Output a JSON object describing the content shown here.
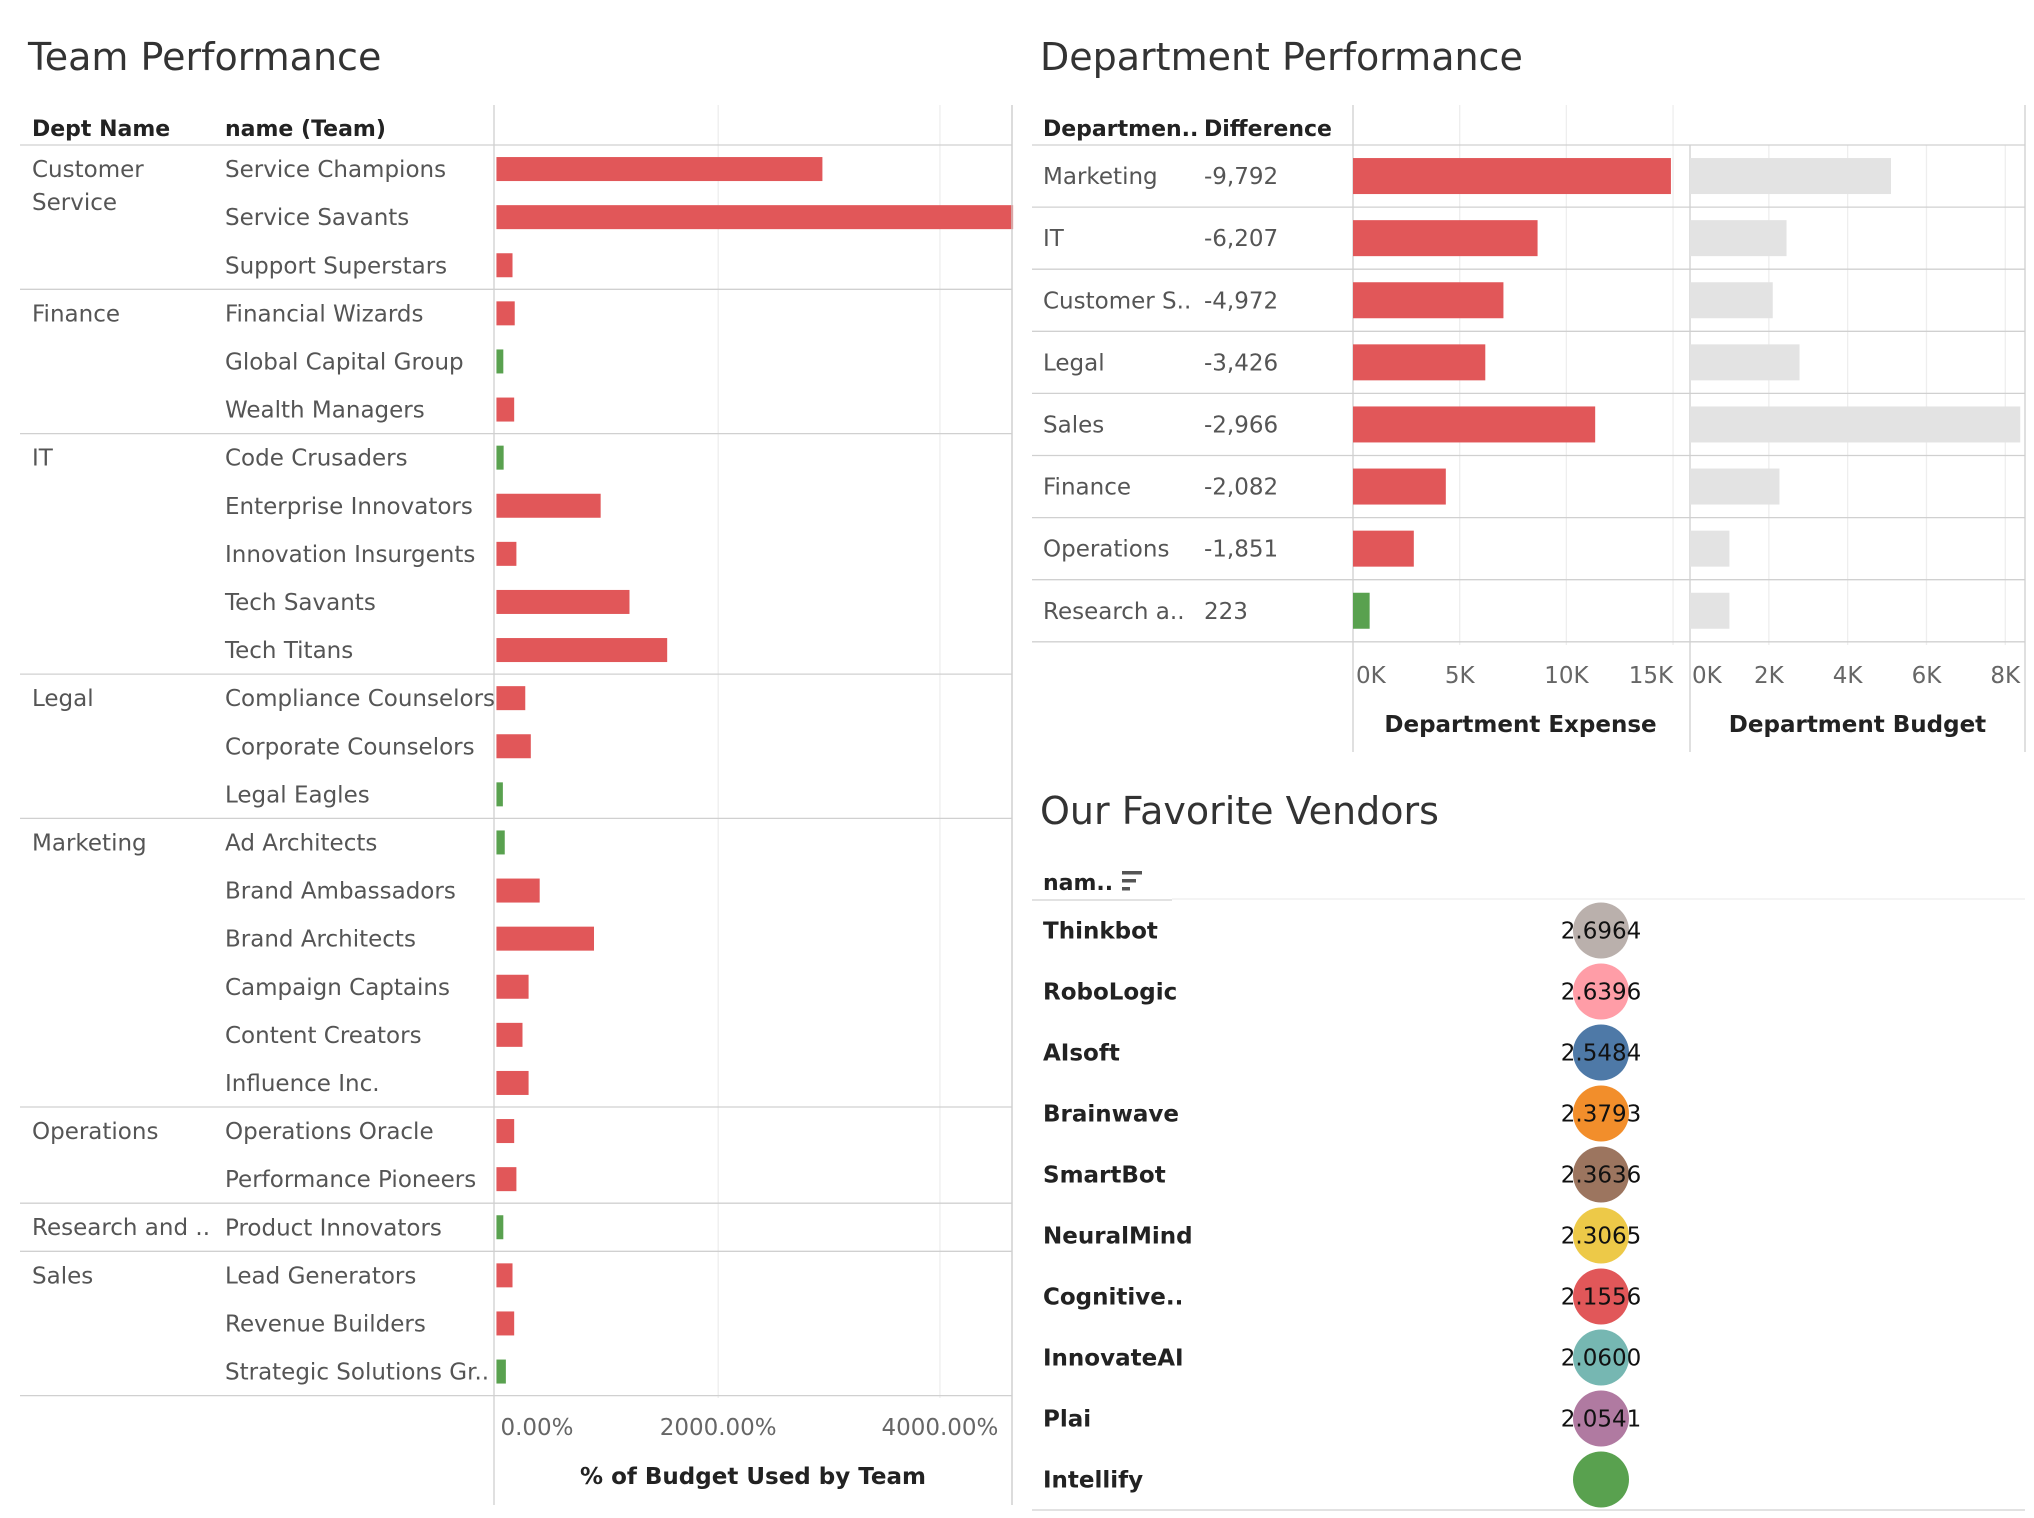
{
  "colors": {
    "over_budget": "#e15759",
    "under_budget": "#59a14f",
    "budget_bar": "#e3e3e3",
    "vendor_palette": [
      "#bab0ac",
      "#ff9da7",
      "#4e79a7",
      "#f28e2b",
      "#9c755f",
      "#edc948",
      "#e15759",
      "#76b7b2",
      "#b07aa1",
      "#59a14f"
    ]
  },
  "team_panel": {
    "title": "Team Performance",
    "col_dept": "Dept Name",
    "col_team": "name (Team)"
  },
  "dept_panel": {
    "title": "Department Performance",
    "col_dept": "Departmen..",
    "col_diff": "Difference"
  },
  "vendor_panel": {
    "title": "Our Favorite Vendors",
    "col_name": "nam..",
    "sort_icon": "sort-descending-icon"
  },
  "chart_data": [
    {
      "id": "team",
      "type": "bar",
      "orientation": "horizontal",
      "xlabel": "% of Budget Used by Team",
      "xlim": [
        -22,
        4650
      ],
      "xticks": [
        0,
        2000,
        4000
      ],
      "xtick_labels": [
        "0.00%",
        "2000.00%",
        "4000.00%"
      ],
      "groups": [
        {
          "dept": "Customer\nService",
          "teams": [
            {
              "name": "Service Champions",
              "value": 2940,
              "status": "over"
            },
            {
              "name": "Service Savants",
              "value": 4660,
              "status": "over"
            },
            {
              "name": "Support Superstars",
              "value": 145,
              "status": "over"
            }
          ]
        },
        {
          "dept": "Finance",
          "teams": [
            {
              "name": "Financial Wizards",
              "value": 165,
              "status": "over"
            },
            {
              "name": "Global Capital Group",
              "value": 62,
              "status": "under"
            },
            {
              "name": "Wealth Managers",
              "value": 160,
              "status": "over"
            }
          ]
        },
        {
          "dept": "IT",
          "teams": [
            {
              "name": "Code Crusaders",
              "value": 65,
              "status": "under"
            },
            {
              "name": "Enterprise Innovators",
              "value": 940,
              "status": "over"
            },
            {
              "name": "Innovation Insurgents",
              "value": 180,
              "status": "over"
            },
            {
              "name": "Tech Savants",
              "value": 1200,
              "status": "over"
            },
            {
              "name": "Tech Titans",
              "value": 1540,
              "status": "over"
            }
          ]
        },
        {
          "dept": "Legal",
          "teams": [
            {
              "name": "Compliance Counselors",
              "value": 260,
              "status": "over"
            },
            {
              "name": "Corporate Counselors",
              "value": 310,
              "status": "over"
            },
            {
              "name": "Legal Eagles",
              "value": 58,
              "status": "under"
            }
          ]
        },
        {
          "dept": "Marketing",
          "teams": [
            {
              "name": "Ad Architects",
              "value": 75,
              "status": "under"
            },
            {
              "name": "Brand Ambassadors",
              "value": 390,
              "status": "over"
            },
            {
              "name": "Brand Architects",
              "value": 880,
              "status": "over"
            },
            {
              "name": "Campaign Captains",
              "value": 290,
              "status": "over"
            },
            {
              "name": "Content Creators",
              "value": 235,
              "status": "over"
            },
            {
              "name": "Influence Inc.",
              "value": 290,
              "status": "over"
            }
          ]
        },
        {
          "dept": "Operations",
          "teams": [
            {
              "name": "Operations Oracle",
              "value": 160,
              "status": "over"
            },
            {
              "name": "Performance Pioneers",
              "value": 180,
              "status": "over"
            }
          ]
        },
        {
          "dept": "Research and ..",
          "teams": [
            {
              "name": "Product Innovators",
              "value": 62,
              "status": "under"
            }
          ]
        },
        {
          "dept": "Sales",
          "teams": [
            {
              "name": "Lead Generators",
              "value": 145,
              "status": "over"
            },
            {
              "name": "Revenue Builders",
              "value": 160,
              "status": "over"
            },
            {
              "name": "Strategic Solutions Gr..",
              "value": 85,
              "status": "under"
            }
          ]
        }
      ]
    },
    {
      "id": "department",
      "type": "bar",
      "orientation": "horizontal",
      "rows": [
        {
          "dept": "Marketing",
          "difference": "-9,792",
          "expense": 14900,
          "budget": 5100,
          "status": "over"
        },
        {
          "dept": "IT",
          "difference": "-6,207",
          "expense": 8650,
          "budget": 2450,
          "status": "over"
        },
        {
          "dept": "Customer S..",
          "difference": "-4,972",
          "expense": 7050,
          "budget": 2100,
          "status": "over"
        },
        {
          "dept": "Legal",
          "difference": "-3,426",
          "expense": 6200,
          "budget": 2780,
          "status": "over"
        },
        {
          "dept": "Sales",
          "difference": "-2,966",
          "expense": 11350,
          "budget": 8380,
          "status": "over"
        },
        {
          "dept": "Finance",
          "difference": "-2,082",
          "expense": 4350,
          "budget": 2270,
          "status": "over"
        },
        {
          "dept": "Operations",
          "difference": "-1,851",
          "expense": 2850,
          "budget": 1000,
          "status": "over"
        },
        {
          "dept": "Research a..",
          "difference": "223",
          "expense": 780,
          "budget": 1000,
          "status": "under"
        }
      ],
      "expense_axis": {
        "label": "Department Expense",
        "xlim": [
          0,
          15700
        ],
        "ticks": [
          0,
          5000,
          10000,
          15000
        ],
        "tick_labels": [
          "0K",
          "5K",
          "10K",
          "15K"
        ]
      },
      "budget_axis": {
        "label": "Department Budget",
        "xlim": [
          0,
          8500
        ],
        "ticks": [
          0,
          2000,
          4000,
          6000,
          8000
        ],
        "tick_labels": [
          "0K",
          "2K",
          "4K",
          "6K",
          "8K"
        ]
      }
    },
    {
      "id": "vendors",
      "type": "table",
      "rows": [
        {
          "name": "Thinkbot",
          "value": "2.6964"
        },
        {
          "name": "RoboLogic",
          "value": "2.6396"
        },
        {
          "name": "AIsoft",
          "value": "2.5484"
        },
        {
          "name": "Brainwave",
          "value": "2.3793"
        },
        {
          "name": "SmartBot",
          "value": "2.3636"
        },
        {
          "name": "NeuralMind",
          "value": "2.3065"
        },
        {
          "name": "Cognitive..",
          "value": "2.1556"
        },
        {
          "name": "InnovateAI",
          "value": "2.0600"
        },
        {
          "name": "Plai",
          "value": "2.0541"
        },
        {
          "name": "Intellify",
          "value": ""
        }
      ]
    }
  ]
}
